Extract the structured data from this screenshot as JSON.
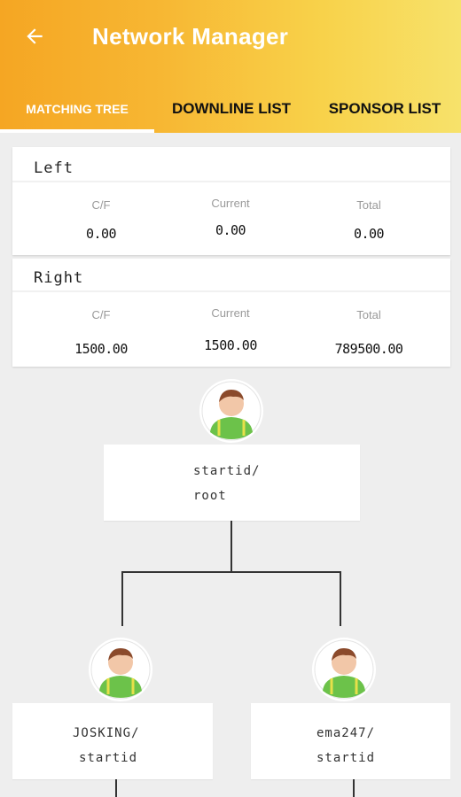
{
  "header": {
    "title": "Network Manager",
    "back_icon": "arrow-left-icon"
  },
  "tabs": [
    {
      "label": "MATCHING TREE",
      "active": true
    },
    {
      "label": "DOWNLINE LIST",
      "active": false
    },
    {
      "label": "SPONSOR LIST",
      "active": false
    }
  ],
  "summary": {
    "left": {
      "label": "Left",
      "cf_header": "C/F",
      "current_header": "Current",
      "total_header": "Total",
      "cf_value": "0.00",
      "current_value": "0.00",
      "total_value": "0.00"
    },
    "right": {
      "label": "Right",
      "cf_header": "C/F",
      "current_header": "Current",
      "total_header": "Total",
      "cf_value": "1500.00",
      "current_value": "1500.00",
      "total_value": "789500.00"
    }
  },
  "tree": {
    "root": {
      "line1": "startid/",
      "line2": "root"
    },
    "left_child": {
      "line1": "JOSKING/",
      "line2": "startid"
    },
    "right_child": {
      "line1": "ema247/",
      "line2": "startid"
    }
  },
  "colors": {
    "appbar_start": "#f5a623",
    "appbar_end": "#f7e26b",
    "avatar_shirt": "#6cc24a"
  }
}
